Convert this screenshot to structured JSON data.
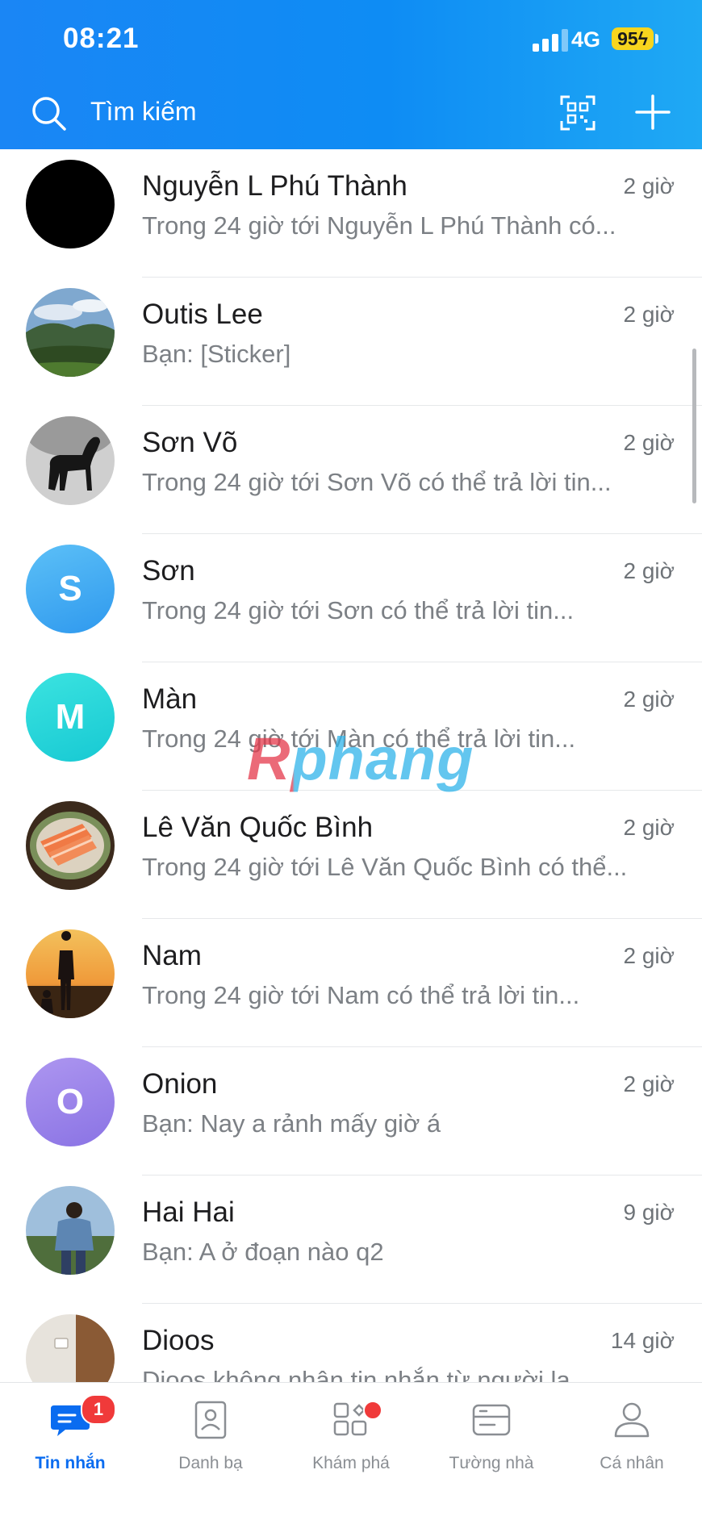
{
  "status_bar": {
    "time": "08:21",
    "network": "4G",
    "battery": "95"
  },
  "search": {
    "placeholder": "Tìm kiếm"
  },
  "conversations": [
    {
      "name": "Nguyễn L Phú Thành",
      "time": "2 giờ",
      "preview": "Trong 24 giờ tới Nguyễn L Phú Thành có...",
      "avatar": {
        "type": "image",
        "description": "black-avatar"
      }
    },
    {
      "name": "Outis Lee",
      "time": "2 giờ",
      "preview": "Bạn: [Sticker]",
      "avatar": {
        "type": "image",
        "description": "landscape-photo"
      }
    },
    {
      "name": "Sơn Võ",
      "time": "2 giờ",
      "preview": "Trong 24 giờ tới Sơn Võ có thể trả lời tin...",
      "avatar": {
        "type": "image",
        "description": "horse-photo"
      }
    },
    {
      "name": "Sơn",
      "time": "2 giờ",
      "preview": "Trong 24 giờ tới Sơn có thể trả lời tin...",
      "avatar": {
        "type": "initial",
        "letter": "S",
        "color": "#3aa9f2"
      }
    },
    {
      "name": "Màn",
      "time": "2 giờ",
      "preview": "Trong 24 giờ tới Màn có thể trả lời tin...",
      "avatar": {
        "type": "initial",
        "letter": "M",
        "color": "#22d6d8"
      }
    },
    {
      "name": "Lê Văn Quốc Bình",
      "time": "2 giờ",
      "preview": "Trong 24 giờ tới Lê Văn Quốc Bình có thể...",
      "avatar": {
        "type": "image",
        "description": "salmon-dish-photo"
      }
    },
    {
      "name": "Nam",
      "time": "2 giờ",
      "preview": "Trong 24 giờ tới Nam có thể trả lời tin...",
      "avatar": {
        "type": "image",
        "description": "sunset-silhouette-photo"
      }
    },
    {
      "name": "Onion",
      "time": "2 giờ",
      "preview": "Bạn: Nay a rảnh mấy giờ á",
      "avatar": {
        "type": "initial",
        "letter": "O",
        "color": "#9a86ec"
      }
    },
    {
      "name": "Hai Hai",
      "time": "9 giờ",
      "preview": "Bạn: A ở đoạn nào q2",
      "avatar": {
        "type": "image",
        "description": "person-outdoor-photo"
      }
    },
    {
      "name": "Dioos",
      "time": "14 giờ",
      "preview": "Dioos không nhận tin nhắn từ người lạ...",
      "avatar": {
        "type": "image",
        "description": "room-photo"
      }
    }
  ],
  "watermark": "Rphang",
  "tabs": [
    {
      "label": "Tin nhắn",
      "icon": "chat-icon",
      "active": true,
      "badge": "1"
    },
    {
      "label": "Danh bạ",
      "icon": "contacts-icon",
      "active": false
    },
    {
      "label": "Khám phá",
      "icon": "discover-icon",
      "active": false,
      "dot": true
    },
    {
      "label": "Tường nhà",
      "icon": "timeline-icon",
      "active": false
    },
    {
      "label": "Cá nhân",
      "icon": "profile-icon",
      "active": false
    }
  ],
  "colors": {
    "header_blue": "#1a86f5",
    "active_tab": "#0a6cf0",
    "badge_red": "#f03a3a"
  }
}
